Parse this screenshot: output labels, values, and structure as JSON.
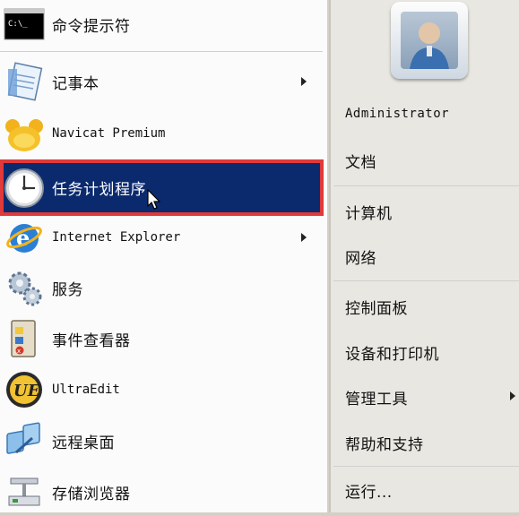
{
  "left_menu": {
    "items": [
      {
        "label": "命令提示符",
        "icon": "cmd-icon",
        "submenu": false,
        "selected": false
      },
      {
        "label": "记事本",
        "icon": "notepad-icon",
        "submenu": true,
        "selected": false
      },
      {
        "label": "Navicat Premium",
        "icon": "navicat-icon",
        "submenu": false,
        "selected": false
      },
      {
        "label": "任务计划程序",
        "icon": "clock-icon",
        "submenu": false,
        "selected": true
      },
      {
        "label": "Internet Explorer",
        "icon": "ie-icon",
        "submenu": true,
        "selected": false
      },
      {
        "label": "服务",
        "icon": "gears-icon",
        "submenu": false,
        "selected": false
      },
      {
        "label": "事件查看器",
        "icon": "event-viewer-icon",
        "submenu": false,
        "selected": false
      },
      {
        "label": "UltraEdit",
        "icon": "ultraedit-icon",
        "submenu": false,
        "selected": false
      },
      {
        "label": "远程桌面",
        "icon": "remote-desktop-icon",
        "submenu": false,
        "selected": false
      },
      {
        "label": "存储浏览器",
        "icon": "storage-icon",
        "submenu": false,
        "selected": false
      }
    ]
  },
  "right_menu": {
    "user_name": "Administrator",
    "items": [
      {
        "label": "文档",
        "submenu": false
      },
      {
        "label": "计算机",
        "submenu": false
      },
      {
        "label": "网络",
        "submenu": false
      },
      {
        "label": "控制面板",
        "submenu": false
      },
      {
        "label": "设备和打印机",
        "submenu": false
      },
      {
        "label": "管理工具",
        "submenu": true
      },
      {
        "label": "帮助和支持",
        "submenu": false
      },
      {
        "label": "运行...",
        "submenu": false
      }
    ]
  },
  "colors": {
    "selection": "#0b2a6e",
    "highlight_frame": "#e03a3a"
  }
}
